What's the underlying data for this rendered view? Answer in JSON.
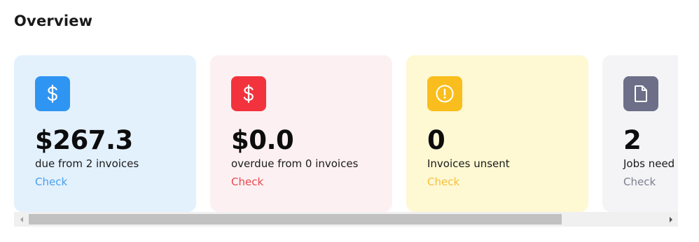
{
  "overview": {
    "title": "Overview"
  },
  "cards": [
    {
      "icon": "dollar-icon",
      "amount": "$267.3",
      "description": "due from 2 invoices",
      "action": "Check",
      "accent": "#2f95f2",
      "background": "#e3f1fd",
      "action_color": "#4a9eea"
    },
    {
      "icon": "dollar-icon",
      "amount": "$0.0",
      "description": "overdue from 0 invoices",
      "action": "Check",
      "accent": "#f2333d",
      "background": "#fdf0f2",
      "action_color": "#e8484f"
    },
    {
      "icon": "alert-circle-icon",
      "amount": "0",
      "description": "Invoices unsent",
      "action": "Check",
      "accent": "#f9be1d",
      "background": "#fef8d3",
      "action_color": "#f3c13e"
    },
    {
      "icon": "document-icon",
      "amount": "2",
      "description": "Jobs need",
      "action": "Check",
      "accent": "#6c6f87",
      "background": "#f4f4f6",
      "action_color": "#7d7f8e"
    }
  ],
  "scrollbar": {
    "position_fraction": 0.0,
    "visible_fraction": 0.84
  }
}
